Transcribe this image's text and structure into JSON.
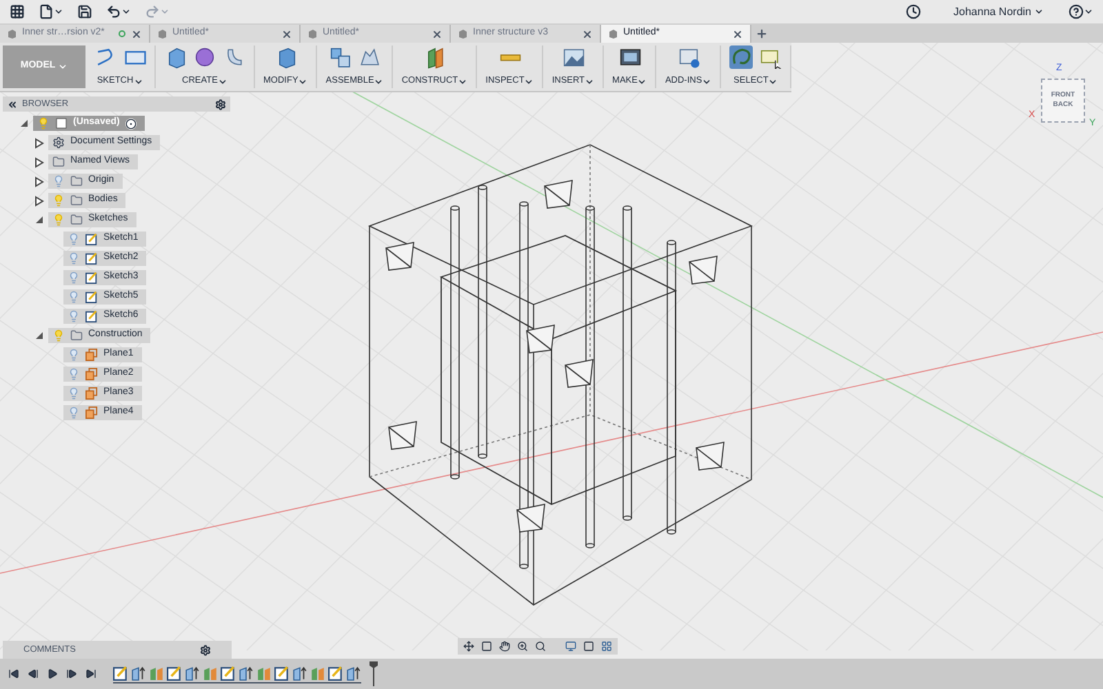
{
  "top_bar": {
    "user": "Johanna Nordin"
  },
  "tabs": [
    {
      "label": "Inner str…rsion v2*",
      "selected": false,
      "saved_dot": true
    },
    {
      "label": "Untitled*",
      "selected": false,
      "saved_dot": false
    },
    {
      "label": "Untitled*",
      "selected": false,
      "saved_dot": false
    },
    {
      "label": "Inner structure v3",
      "selected": false,
      "saved_dot": false
    },
    {
      "label": "Untitled*",
      "selected": true,
      "saved_dot": false
    }
  ],
  "toolbar": {
    "workspace": "MODEL",
    "groups": [
      {
        "label": "SKETCH"
      },
      {
        "label": "CREATE"
      },
      {
        "label": "MODIFY"
      },
      {
        "label": "ASSEMBLE"
      },
      {
        "label": "CONSTRUCT"
      },
      {
        "label": "INSPECT"
      },
      {
        "label": "INSERT"
      },
      {
        "label": "MAKE"
      },
      {
        "label": "ADD-INS"
      },
      {
        "label": "SELECT"
      }
    ]
  },
  "browser": {
    "title": "BROWSER",
    "tree": [
      {
        "label": "(Unsaved)",
        "kind": "component",
        "visible": true,
        "expanded": true,
        "children": [
          {
            "label": "Document Settings",
            "kind": "settings",
            "expanded": false
          },
          {
            "label": "Named Views",
            "kind": "folder",
            "expanded": false
          },
          {
            "label": "Origin",
            "kind": "folder",
            "visible": false,
            "expanded": false
          },
          {
            "label": "Bodies",
            "kind": "folder",
            "visible": true,
            "expanded": false
          },
          {
            "label": "Sketches",
            "kind": "folder",
            "visible": true,
            "expanded": true,
            "children": [
              {
                "label": "Sketch1",
                "kind": "sketch",
                "visible": false
              },
              {
                "label": "Sketch2",
                "kind": "sketch",
                "visible": false
              },
              {
                "label": "Sketch3",
                "kind": "sketch",
                "visible": false
              },
              {
                "label": "Sketch5",
                "kind": "sketch",
                "visible": false
              },
              {
                "label": "Sketch6",
                "kind": "sketch",
                "visible": false
              }
            ]
          },
          {
            "label": "Construction",
            "kind": "folder",
            "visible": true,
            "expanded": true,
            "children": [
              {
                "label": "Plane1",
                "kind": "plane",
                "visible": false
              },
              {
                "label": "Plane2",
                "kind": "plane",
                "visible": false
              },
              {
                "label": "Plane3",
                "kind": "plane",
                "visible": false
              },
              {
                "label": "Plane4",
                "kind": "plane",
                "visible": false
              }
            ]
          }
        ]
      }
    ]
  },
  "view_cube": {
    "faces": [
      "FRONT",
      "BACK"
    ],
    "axes": [
      "Z",
      "X",
      "Y"
    ]
  },
  "comments": {
    "title": "COMMENTS"
  }
}
